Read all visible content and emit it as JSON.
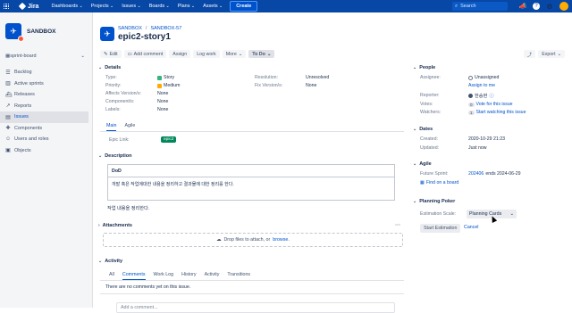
{
  "topbar": {
    "brand": "Jira",
    "nav": [
      "Dashboards",
      "Projects",
      "Issues",
      "Boards",
      "Plans",
      "Assets"
    ],
    "create": "Create",
    "search_placeholder": "Search"
  },
  "sidebar": {
    "project_name": "SANDBOX",
    "board": "sprint-board",
    "items": [
      {
        "label": "Backlog",
        "icon": "backlog-icon"
      },
      {
        "label": "Active sprints",
        "icon": "sprint-icon"
      },
      {
        "label": "Releases",
        "icon": "ship-icon"
      },
      {
        "label": "Reports",
        "icon": "chart-icon"
      },
      {
        "label": "Issues",
        "icon": "issues-icon"
      },
      {
        "label": "Components",
        "icon": "puzzle-icon"
      },
      {
        "label": "Users and roles",
        "icon": "users-icon"
      },
      {
        "label": "Objects",
        "icon": "objects-icon"
      }
    ]
  },
  "issue": {
    "breadcrumb_project": "SANDBOX",
    "breadcrumb_key": "SANDBOX-57",
    "title": "epic2-story1"
  },
  "toolbar": {
    "edit": "Edit",
    "add_comment": "Add comment",
    "assign": "Assign",
    "log_work": "Log work",
    "more": "More",
    "status": "To Do",
    "export": "Export"
  },
  "details": {
    "header": "Details",
    "type_label": "Type:",
    "type": "Story",
    "priority_label": "Priority:",
    "priority": "Medium",
    "affects_label": "Affects Version/s:",
    "affects": "None",
    "components_label": "Component/s:",
    "components": "None",
    "labels_label": "Labels:",
    "labels": "None",
    "resolution_label": "Resolution:",
    "resolution": "Unresolved",
    "fix_label": "Fix Version/s:",
    "fix": "None",
    "tabs": [
      "Main",
      "Agile"
    ],
    "epic_link_label": "Epic Link:",
    "epic_link": "epic2"
  },
  "description": {
    "header": "Description",
    "table_header": "DoD",
    "table_cell": "개발 혹은 작업에대한 내용을 정리하고 결과물에 대한 정리를 한다.",
    "text": "작업 내용을 정리한다."
  },
  "attachments": {
    "header": "Attachments",
    "drop_text": "Drop files to attach, or",
    "browse": "browse."
  },
  "activity": {
    "header": "Activity",
    "tabs": [
      "All",
      "Comments",
      "Work Log",
      "History",
      "Activity",
      "Transitions"
    ],
    "empty": "There are no comments yet on this issue.",
    "comment_placeholder": "Add a comment..."
  },
  "people": {
    "header": "People",
    "assignee_label": "Assignee:",
    "assignee": "Unassigned",
    "assign_me": "Assign to me",
    "reporter_label": "Reporter:",
    "reporter": "한승현",
    "votes_label": "Votes:",
    "votes": "0",
    "vote_link": "Vote for this issue",
    "watchers_label": "Watchers:",
    "watchers": "1",
    "watch_link": "Start watching this issue"
  },
  "dates": {
    "header": "Dates",
    "created_label": "Created:",
    "created": "2020-10-29 21:23",
    "updated_label": "Updated:",
    "updated": "Just now"
  },
  "agile": {
    "header": "Agile",
    "sprint_label": "Future Sprint:",
    "sprint": "202406",
    "sprint_end": "ends 2024-06-29",
    "find_board": "Find on a board"
  },
  "poker": {
    "header": "Planning Poker",
    "scale_label": "Estimation Scale:",
    "scale": "Planning Cards",
    "start": "Start Estimation",
    "cancel": "Cancel"
  },
  "colors": {
    "topbar": "#0747a6",
    "link": "#0052cc",
    "story": "#36b37e",
    "priority": "#ffab00",
    "epic": "#00875a"
  }
}
